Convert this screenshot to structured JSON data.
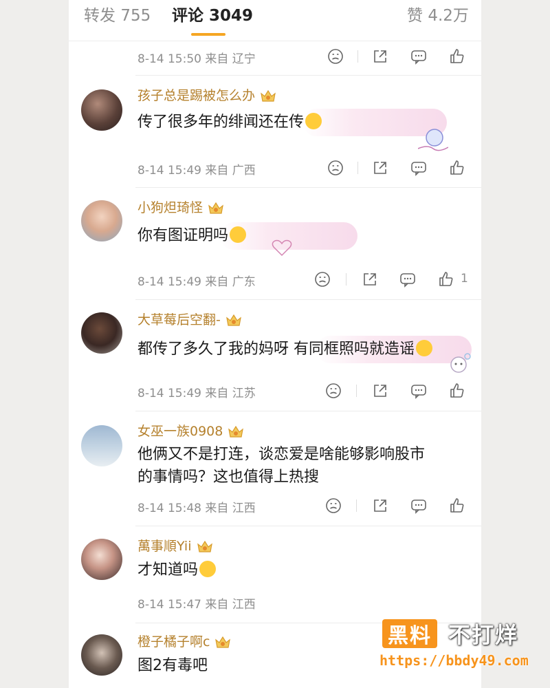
{
  "tabs": {
    "repost_label": "转发",
    "repost_count": "755",
    "comments_label": "评论",
    "comments_count": "3049",
    "likes_label": "赞",
    "likes_count": "4.2万"
  },
  "top_meta": {
    "meta": "8-14 15:50 来自 辽宁"
  },
  "comments": [
    {
      "user": "孩子总是踢被怎么办",
      "text": "传了很多年的绯闻还在传",
      "emoji": "laughing-crying-emoji",
      "meta": "8-14 15:49 来自 广西",
      "likes": ""
    },
    {
      "user": "小狗炟琦怪",
      "text": "你有图证明吗",
      "emoji": "laughing-crying-emoji",
      "meta": "8-14 15:49 来自 广东",
      "likes": "1"
    },
    {
      "user": "大草莓后空翻-",
      "text": "都传了多久了我的妈呀 有同框照吗就造谣",
      "emoji": "smile-emoji",
      "meta": "8-14 15:49 来自 江苏",
      "likes": ""
    },
    {
      "user": "女巫一族0908",
      "text_line1": "他俩又不是打连，谈恋爱是啥能够影响股市",
      "text_line2": "的事情吗？这也值得上热搜",
      "meta": "8-14 15:48 来自 江西",
      "likes": ""
    },
    {
      "user": "萬事順Yii",
      "text": "才知道吗",
      "emoji": "crying-emoji",
      "meta": "8-14 15:47 来自 江西",
      "likes": ""
    },
    {
      "user": "橙子橘子啊c",
      "text": "图2有毒吧"
    }
  ],
  "watermark": {
    "brand_box": "黑料",
    "brand_text": "不打烊",
    "url": "https://bbdy49.com"
  },
  "colors": {
    "username": "#b5812d",
    "accent": "#f5a623",
    "meta": "#8e8e8e",
    "watermark": "#f7941d"
  }
}
